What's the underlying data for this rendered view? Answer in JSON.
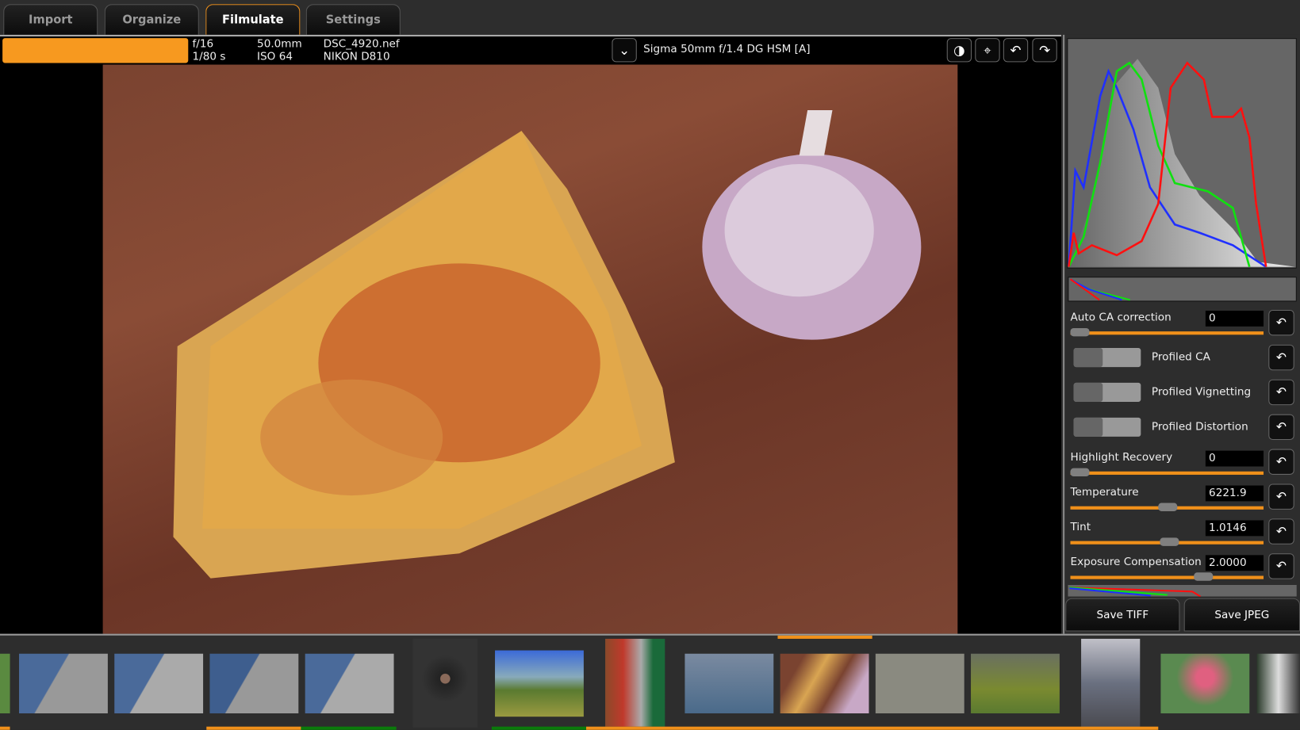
{
  "tabs": [
    "Import",
    "Organize",
    "Filmulate",
    "Settings"
  ],
  "active_tab": "Filmulate",
  "info": {
    "aperture": "f/16",
    "shutter": "1/80 s",
    "focal": "50.0mm",
    "iso": "ISO 64",
    "filename": "DSC_4920.nef",
    "camera": "NIKON D810",
    "lens": "Sigma 50mm f/1.4 DG HSM [A]",
    "progress": 1.0
  },
  "toolbar": {
    "icons": [
      "contrast-icon",
      "crop-icon",
      "rotate-left-icon",
      "rotate-right-icon"
    ]
  },
  "controls": {
    "auto_ca": {
      "label": "Auto CA correction",
      "value": "0"
    },
    "profiled_ca": {
      "label": "Profiled CA",
      "on": false
    },
    "profiled_vignetting": {
      "label": "Profiled Vignetting",
      "on": false
    },
    "profiled_distortion": {
      "label": "Profiled Distortion",
      "on": false
    },
    "highlight": {
      "label": "Highlight Recovery",
      "value": "0"
    },
    "temperature": {
      "label": "Temperature",
      "value": "6221.9"
    },
    "tint": {
      "label": "Tint",
      "value": "1.0146"
    },
    "exposure": {
      "label": "Exposure Compensation",
      "value": "2.0000"
    }
  },
  "buttons": {
    "save_tiff": "Save TIFF",
    "save_jpeg": "Save JPEG"
  },
  "colors": {
    "accent": "#f0901a",
    "green": "#0a7a0a"
  }
}
